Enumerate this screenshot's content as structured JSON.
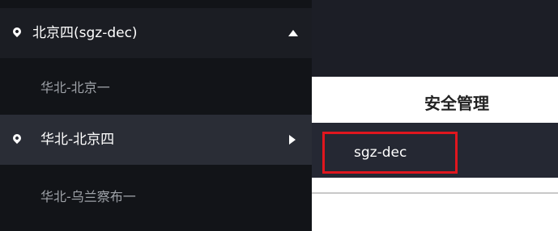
{
  "header": {
    "page_title": "安全管理"
  },
  "region_dropdown": {
    "selected_label": "北京四(sgz-dec)",
    "items": [
      {
        "label": "华北-北京一"
      },
      {
        "label": "华北-北京四",
        "has_submenu": true
      },
      {
        "label": "华北-乌兰察布一"
      }
    ]
  },
  "submenu": {
    "items": [
      {
        "label": "sgz-dec"
      }
    ]
  },
  "colors": {
    "dark_bg": "#121418",
    "highlight_bg": "#2a2d36",
    "callout_border": "#e0161e"
  }
}
